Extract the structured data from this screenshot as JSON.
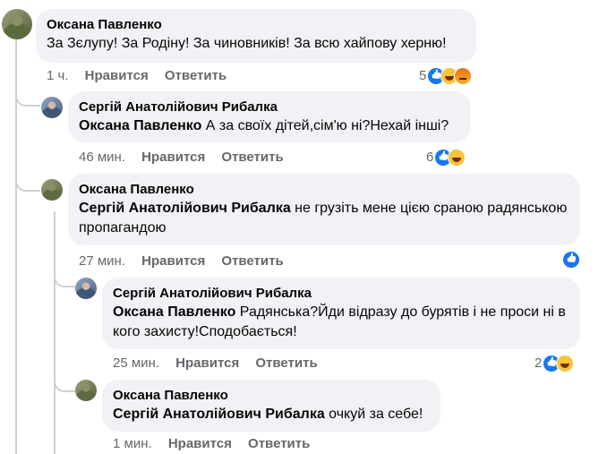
{
  "comments": [
    {
      "author": "Оксана Павленко",
      "mention": "",
      "text": "За Зєлупу! За Родіну! За чиновників! За всю хайпову херню!",
      "time": "1 ч.",
      "like_label": "Нравится",
      "reply_label": "Ответить",
      "reaction_count": "5",
      "reactions": [
        "like-icon",
        "haha-icon",
        "angry-icon"
      ]
    },
    {
      "author": "Сергій Анатолійович Рибалка",
      "mention": "Оксана Павленко",
      "text": " А за своїх дітей,сім'ю ні?Нехай інші?",
      "time": "46 мин.",
      "like_label": "Нравится",
      "reply_label": "Ответить",
      "reaction_count": "6",
      "reactions": [
        "like-icon",
        "haha-icon"
      ]
    },
    {
      "author": "Оксана Павленко",
      "mention": "Сергій Анатолійович Рибалка",
      "text": " не грузіть мене цією сраною радянською пропагандою",
      "time": "27 мин.",
      "like_label": "Нравится",
      "reply_label": "Ответить",
      "reaction_count": "",
      "reactions": [
        "like-icon"
      ]
    },
    {
      "author": "Сергій Анатолійович Рибалка",
      "mention": "Оксана Павленко",
      "text": " Радянська?Йди відразу до бурятів і не проси ні в кого захисту!Сподобається!",
      "time": "25 мин.",
      "like_label": "Нравится",
      "reply_label": "Ответить",
      "reaction_count": "2",
      "reactions": [
        "like-icon",
        "haha-icon"
      ]
    },
    {
      "author": "Оксана Павленко",
      "mention": "Сергій Анатолійович Рибалка",
      "text": " очкуй за себе!",
      "time": "1 мин.",
      "like_label": "Нравится",
      "reply_label": "Ответить",
      "reaction_count": "",
      "reactions": []
    }
  ]
}
